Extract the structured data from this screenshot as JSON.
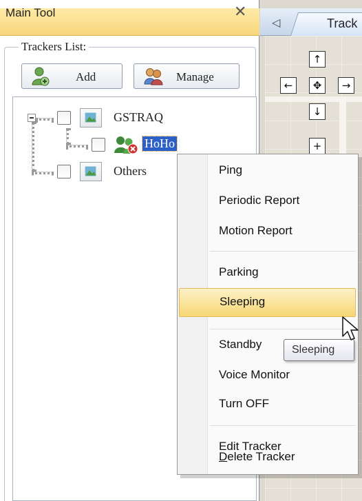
{
  "panel": {
    "title": "Main Tool",
    "close_symbol": "✕",
    "group_legend": "Trackers List:",
    "add_button": "Add",
    "manage_button": "Manage"
  },
  "tree": {
    "nodes": [
      {
        "label": "GSTRAQ",
        "expanded": true,
        "checked": false
      },
      {
        "label": "HoHo",
        "selected": true,
        "checked": false,
        "status_icon": "tracker-offline-icon"
      },
      {
        "label": "Others",
        "checked": false
      }
    ],
    "expander_symbol": "−"
  },
  "right_pane": {
    "tab_label": "Track",
    "tab_arrow": "◁",
    "nav": {
      "up": "↑",
      "left": "←",
      "center": "✥",
      "right": "→",
      "down": "↓",
      "zoom_in": "+"
    }
  },
  "context_menu": {
    "items": [
      {
        "label": "Ping"
      },
      {
        "label": "Periodic Report"
      },
      {
        "label": "Motion Report"
      },
      {
        "label": "Parking"
      },
      {
        "label": "Sleeping",
        "highlighted": true
      },
      {
        "label": "Standby"
      },
      {
        "label": "Voice Monitor"
      },
      {
        "label": "Turn OFF"
      },
      {
        "label": "Edit Tracker"
      },
      {
        "label": "Delete Tracker",
        "mnemonic": "D"
      }
    ]
  },
  "tooltip": {
    "text": "Sleeping"
  },
  "colors": {
    "header_yellow": "#f8d77c",
    "selection_blue": "#2d5fc8",
    "menu_highlight": "#f8d774"
  }
}
